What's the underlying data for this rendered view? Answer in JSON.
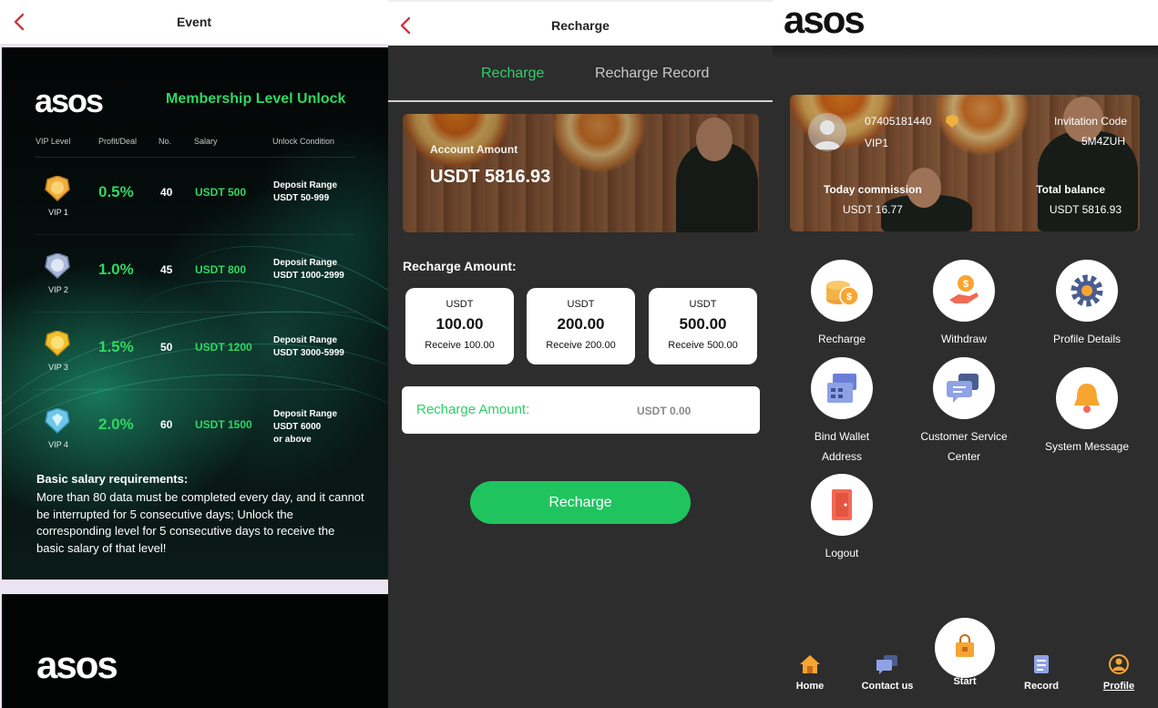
{
  "event_page": {
    "header": {
      "title": "Event"
    },
    "brand": "asos",
    "headline": "Membership Level Unlock",
    "columns": [
      "VIP Level",
      "Profit/Deal",
      "No.",
      "Salary",
      "Unlock Condition"
    ],
    "tiers": [
      {
        "vip": "VIP 1",
        "profit": "0.5%",
        "no": "40",
        "salary": "USDT 500",
        "cond1": "Deposit Range",
        "cond2": "USDT 50-999",
        "cond3": "",
        "medal": "#f0b13c"
      },
      {
        "vip": "VIP 2",
        "profit": "1.0%",
        "no": "45",
        "salary": "USDT 800",
        "cond1": "Deposit Range",
        "cond2": "USDT 1000-2999",
        "cond3": "",
        "medal": "#aab8d8"
      },
      {
        "vip": "VIP 3",
        "profit": "1.5%",
        "no": "50",
        "salary": "USDT 1200",
        "cond1": "Deposit Range",
        "cond2": "USDT 3000-5999",
        "cond3": "",
        "medal": "#f3c12e"
      },
      {
        "vip": "VIP 4",
        "profit": "2.0%",
        "no": "60",
        "salary": "USDT 1500",
        "cond1": "Deposit Range",
        "cond2": "USDT 6000",
        "cond3": "or above",
        "medal": "#6fc7e8"
      }
    ],
    "requirements_title": "Basic salary requirements:",
    "requirements_text": "More than 80 data must be completed every day, and it cannot be interrupted for 5 consecutive days; Unlock the corresponding level for 5 consecutive days to receive the basic salary of that level!",
    "second_card_brand": "asos"
  },
  "recharge_page": {
    "header": {
      "title": "Recharge"
    },
    "tabs": [
      {
        "label": "Recharge",
        "active": true
      },
      {
        "label": "Recharge Record",
        "active": false
      }
    ],
    "account_label": "Account Amount",
    "account_value": "USDT 5816.93",
    "amount_heading": "Recharge Amount:",
    "options": [
      {
        "currency": "USDT",
        "value": "100.00",
        "receive": "Receive 100.00"
      },
      {
        "currency": "USDT",
        "value": "200.00",
        "receive": "Receive 200.00"
      },
      {
        "currency": "USDT",
        "value": "500.00",
        "receive": "Receive 500.00"
      }
    ],
    "input_label": "Recharge Amount:",
    "input_value": "USDT 0.00",
    "button_label": "Recharge",
    "accent_color": "#1fc45f"
  },
  "profile_page": {
    "brand": "asos",
    "phone": "07405181440",
    "vip": "VIP1",
    "invitation_label": "Invitation Code",
    "invitation_code": "5M4ZUH",
    "today_commission_label": "Today commission",
    "today_commission_value": "USDT 16.77",
    "total_balance_label": "Total balance",
    "total_balance_value": "USDT 5816.93",
    "menu": [
      {
        "label": "Recharge",
        "icon": "coins-icon"
      },
      {
        "label": "Withdraw",
        "icon": "withdraw-hand-icon"
      },
      {
        "label": "Profile Details",
        "icon": "gear-icon"
      },
      {
        "label": "Bind Wallet Address",
        "icon": "wallet-card-icon"
      },
      {
        "label": "Customer Service Center",
        "icon": "chat-bubbles-icon"
      },
      {
        "label": "System Message",
        "icon": "bell-icon"
      },
      {
        "label": "Logout",
        "icon": "logout-door-icon"
      }
    ],
    "nav": [
      {
        "label": "Home",
        "icon": "home-icon"
      },
      {
        "label": "Contact us",
        "icon": "contact-chat-icon"
      },
      {
        "label": "Start",
        "icon": "shopping-bag-icon"
      },
      {
        "label": "Record",
        "icon": "record-doc-icon"
      },
      {
        "label": "Profile",
        "icon": "profile-user-icon",
        "active": true
      }
    ]
  }
}
